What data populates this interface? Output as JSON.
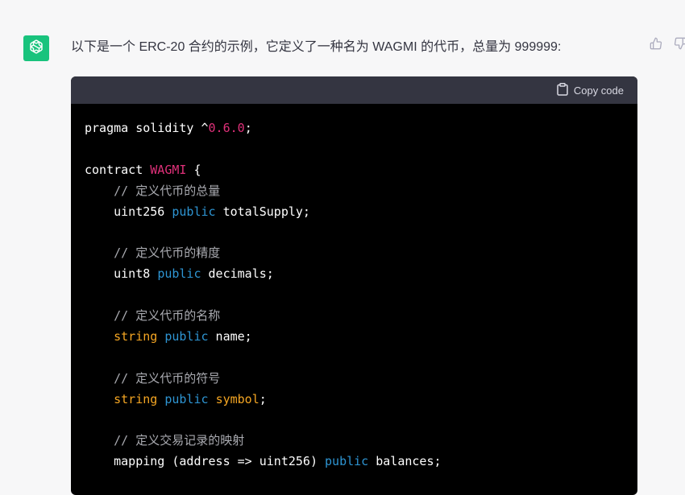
{
  "message": {
    "text": "以下是一个 ERC-20 合约的示例，它定义了一种名为 WAGMI 的代币，总量为 999999:"
  },
  "code_block": {
    "copy_label": "Copy code",
    "lines": [
      [
        {
          "t": "pragma solidity ^",
          "c": "plain"
        },
        {
          "t": "0.6.0",
          "c": "number"
        },
        {
          "t": ";",
          "c": "plain"
        }
      ],
      [],
      [
        {
          "t": "contract ",
          "c": "plain"
        },
        {
          "t": "WAGMI",
          "c": "title"
        },
        {
          "t": " {",
          "c": "plain"
        }
      ],
      [
        {
          "t": "    ",
          "c": "plain"
        },
        {
          "t": "// 定义代币的总量",
          "c": "comment"
        }
      ],
      [
        {
          "t": "    uint256 ",
          "c": "plain"
        },
        {
          "t": "public",
          "c": "keyword"
        },
        {
          "t": " totalSupply;",
          "c": "plain"
        }
      ],
      [],
      [
        {
          "t": "    ",
          "c": "plain"
        },
        {
          "t": "// 定义代币的精度",
          "c": "comment"
        }
      ],
      [
        {
          "t": "    uint8 ",
          "c": "plain"
        },
        {
          "t": "public",
          "c": "keyword"
        },
        {
          "t": " decimals;",
          "c": "plain"
        }
      ],
      [],
      [
        {
          "t": "    ",
          "c": "plain"
        },
        {
          "t": "// 定义代币的名称",
          "c": "comment"
        }
      ],
      [
        {
          "t": "    ",
          "c": "plain"
        },
        {
          "t": "string",
          "c": "type"
        },
        {
          "t": " ",
          "c": "plain"
        },
        {
          "t": "public",
          "c": "keyword"
        },
        {
          "t": " name;",
          "c": "plain"
        }
      ],
      [],
      [
        {
          "t": "    ",
          "c": "plain"
        },
        {
          "t": "// 定义代币的符号",
          "c": "comment"
        }
      ],
      [
        {
          "t": "    ",
          "c": "plain"
        },
        {
          "t": "string",
          "c": "type"
        },
        {
          "t": " ",
          "c": "plain"
        },
        {
          "t": "public",
          "c": "keyword"
        },
        {
          "t": " ",
          "c": "plain"
        },
        {
          "t": "symbol",
          "c": "type"
        },
        {
          "t": ";",
          "c": "plain"
        }
      ],
      [],
      [
        {
          "t": "    ",
          "c": "plain"
        },
        {
          "t": "// 定义交易记录的映射",
          "c": "comment"
        }
      ],
      [
        {
          "t": "    mapping (address => uint256) ",
          "c": "plain"
        },
        {
          "t": "public",
          "c": "keyword"
        },
        {
          "t": " balances;",
          "c": "plain"
        }
      ]
    ]
  },
  "icons": {
    "avatar": "openai-logo-icon",
    "copy": "clipboard-icon",
    "thumbs_up": "thumbs-up-icon",
    "thumbs_down": "thumbs-down-icon"
  },
  "colors": {
    "avatar_bg": "#19c37d",
    "code_bg": "#000000",
    "code_header_bg": "#343541",
    "page_bg": "#f7f7f8"
  }
}
